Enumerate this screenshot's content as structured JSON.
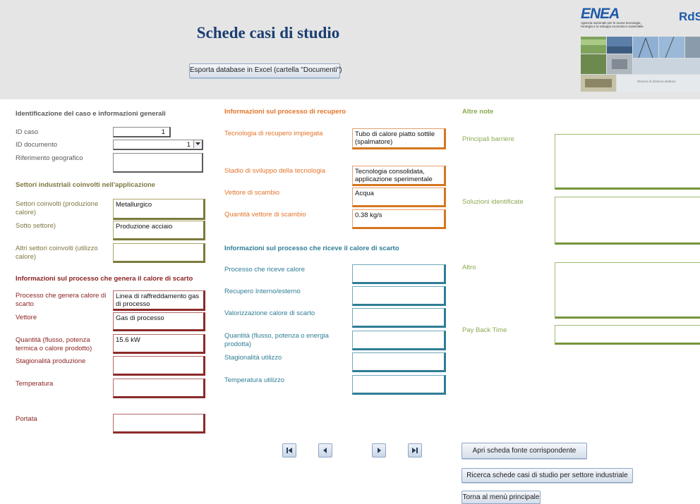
{
  "header": {
    "title": "Schede casi di studio",
    "export_button": "Esporta database in Excel (cartella \"Documenti\")",
    "logo_enea": "ENEA",
    "logo_enea_subtitle_1": "Agenzia nazionale per le nuove tecnologie,",
    "logo_enea_subtitle_2": "l'energia e lo sviluppo economico sostenibile",
    "logo_rds": "RdS",
    "banner_caption": "Ricerca di Sistema elettrico"
  },
  "left": {
    "section_general": "Identificazione del caso e informazioni generali",
    "id_caso_label": "ID caso",
    "id_caso_value": "1",
    "id_documento_label": "ID documento",
    "id_documento_value": "1",
    "riferimento_label": "Riferimento geografico",
    "riferimento_value": "",
    "section_settori": "Settori industriali coinvolti nell'applicazione",
    "settori_label": "Settori coinvolti (produzione calore)",
    "settori_value": "Metallurgico",
    "sotto_settore_label": "Sotto settore)",
    "sotto_settore_value": "Produzione acciaio",
    "altri_settori_label": "Altri settori coinvolti (utilizzo calore)",
    "altri_settori_value": "",
    "section_genera": "Informazioni sul processo che genera il calore di scarto",
    "processo_genera_label": "Processo che genera calore di scarto",
    "processo_genera_value": "Linea di raffreddamento gas di processo",
    "vettore_label": "Vettore",
    "vettore_value": "Gas di processo",
    "quantita_label": "Quantità (flusso, potenza termica o calore prodotto)",
    "quantita_value": "15.6 kW",
    "stagionalita_label": "Stagionalità produzione",
    "stagionalita_value": "",
    "temperatura_label": "Temperatura",
    "temperatura_value": "",
    "portata_label": "Portata",
    "portata_value": ""
  },
  "middle": {
    "section_recupero": "Informazioni sul processo di recupero",
    "tecnologia_label": "Tecnologia di recupero impiegata",
    "tecnologia_value": "Tubo di calore piatto sottile (spalmatore)",
    "stadio_label": "Stadio di sviluppo della tecnologia",
    "stadio_value": "Tecnologia consolidata, applicazione sperimentale",
    "vettore_scambio_label": "Vettore di scambio",
    "vettore_scambio_value": "Acqua",
    "quantita_vettore_label": "Quantità vettore di scambio",
    "quantita_vettore_value": "0.38 kg/s",
    "section_riceve": "Informazioni sul processo che riceve il calore di scarto",
    "processo_riceve_label": "Processo che riceve calore",
    "processo_riceve_value": "",
    "recupero_label": "Recupero Interno/esterno",
    "recupero_value": "",
    "valorizzazione_label": "Valorizzazione calore di scarto",
    "valorizzazione_value": "",
    "quantita_energia_label": "Quantità (flusso, potenza o energia prodotta)",
    "quantita_energia_value": "",
    "stagionalita_utilizzo_label": "Stagionalità utilizzo",
    "stagionalita_utilizzo_value": "",
    "temperatura_utilizzo_label": "Temperatura utilizzo",
    "temperatura_utilizzo_value": ""
  },
  "right": {
    "section_note": "Altre note",
    "barriere_label": "Principali barriere",
    "barriere_value": "",
    "soluzioni_label": "Soluzioni identificate",
    "soluzioni_value": "",
    "altro_label": "Altro",
    "altro_value": "",
    "payback_label": "Pay Back Time",
    "payback_value": ""
  },
  "footer": {
    "first_icon": "first-record-icon",
    "prev_icon": "previous-record-icon",
    "next_icon": "next-record-icon",
    "last_icon": "last-record-icon",
    "apri_button": "Apri scheda fonte corrispondente",
    "ricerca_button": "Ricerca schede casi di studio per settore industriale",
    "torna_button": "Torna al menù principale"
  },
  "colors": {
    "title": "#1c3e72",
    "red": "#8c2323",
    "orange": "#e3742a",
    "teal": "#2f7d96",
    "green": "#8aaa52",
    "olive": "#7f7740"
  }
}
